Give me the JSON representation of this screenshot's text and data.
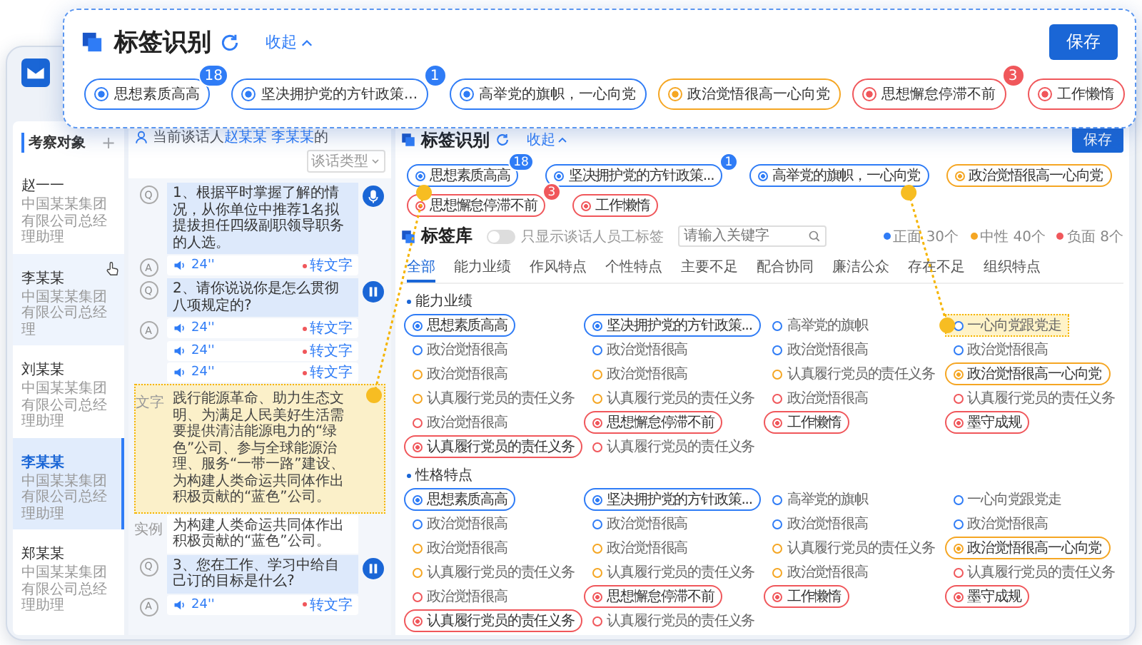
{
  "callout": {
    "title": "标签识别",
    "collapse": "收起",
    "save": "保存",
    "tags": [
      {
        "label": "思想素质高高",
        "color": "#2f7cf6",
        "selected": true,
        "badge": "18"
      },
      {
        "label": "坚决拥护党的方针政策...",
        "color": "#2f7cf6",
        "selected": true,
        "badge": "1"
      },
      {
        "label": "高举党的旗帜，一心向党",
        "color": "#2f7cf6",
        "selected": true
      },
      {
        "label": "政治觉悟很高一心向党",
        "color": "#f5a623",
        "selected": true
      },
      {
        "label": "思想懈怠停滞不前",
        "color": "#f0575b",
        "selected": true,
        "badge": "3"
      },
      {
        "label": "工作懒惰",
        "color": "#f0575b",
        "selected": true
      }
    ]
  },
  "candidates": {
    "title": "考察对象",
    "add": "+",
    "items": [
      {
        "name": "赵一一",
        "position": "中国某某集团有限公司总经理助理",
        "selected": false,
        "hovered": false
      },
      {
        "name": "李某某",
        "position": "中国某某集团有限公司总经理",
        "selected": false,
        "hovered": true
      },
      {
        "name": "刘某某",
        "position": "中国某某集团有限公司总经理助理",
        "selected": false,
        "hovered": false
      },
      {
        "name": "李某某",
        "position": "中国某某集团有限公司总经理助理",
        "selected": true,
        "hovered": false
      },
      {
        "name": "郑某某",
        "position": "中国某某集团有限公司总经理助理",
        "selected": false,
        "hovered": false
      }
    ]
  },
  "conversation": {
    "label": "当前谈话人",
    "names": "赵某某 李某某",
    "suffix": "的",
    "filter": "谈话类型",
    "items": [
      {
        "kind": "question",
        "marker": "Q",
        "text": "1、根据平时掌握了解的情况，从你单位中推荐1名拟提拔担任四级副职领导职务的人选。",
        "recording": true
      },
      {
        "kind": "audio",
        "marker": "A",
        "duration": "24''",
        "convert": "转文字"
      },
      {
        "kind": "question",
        "marker": "Q",
        "text": "2、请你说说你是怎么贯彻八项规定的?",
        "recording": false
      },
      {
        "kind": "audio",
        "marker": "A",
        "duration": "24''",
        "convert": "转文字"
      },
      {
        "kind": "audio",
        "duration": "24''",
        "convert": "转文字"
      },
      {
        "kind": "audio",
        "duration": "24''",
        "convert": "转文字"
      },
      {
        "kind": "transcript",
        "label": "文字",
        "text": "践行能源革命、助力生态文明、为满足人民美好生活需要提供清洁能源电力的“绿色”公司、参与全球能源治理、服务“一带一路”建设、为构建人类命运共同体作出积极贡献的“蓝色”公司。",
        "highlighted": true
      },
      {
        "kind": "example",
        "label": "实例",
        "text": "为构建人类命运共同体作出积极贡献的“蓝色”公司。"
      },
      {
        "kind": "question",
        "marker": "Q",
        "text": "3、您在工作、学习中给自己订的目标是什么?",
        "recording": false
      },
      {
        "kind": "audio",
        "marker": "A",
        "duration": "24''",
        "convert": "转文字"
      }
    ]
  },
  "tag_panel": {
    "title": "标签识别",
    "collapse": "收起",
    "save": "保存",
    "tags": [
      {
        "label": "思想素质高高",
        "color": "#2f7cf6",
        "selected": true,
        "badge": "18"
      },
      {
        "label": "坚决拥护党的方针政策...",
        "color": "#2f7cf6",
        "selected": true,
        "badge": "1"
      },
      {
        "label": "高举党的旗帜，一心向党",
        "color": "#2f7cf6",
        "selected": true
      },
      {
        "label": "政治觉悟很高一心向党",
        "color": "#f5a623",
        "selected": true
      },
      {
        "label": "思想懈怠停滞不前",
        "color": "#f0575b",
        "selected": true,
        "badge": "3"
      },
      {
        "label": "工作懒惰",
        "color": "#f0575b",
        "selected": true
      }
    ],
    "library": {
      "title": "标签库",
      "toggle": {
        "label": "只显示谈话人员工标签",
        "on": false
      },
      "search": {
        "placeholder": "请输入关键字"
      },
      "legend": [
        {
          "label": "正面 30个",
          "color": "#2f7cf6"
        },
        {
          "label": "中性 40个",
          "color": "#f5a623"
        },
        {
          "label": "负面 8个",
          "color": "#f0575b"
        }
      ],
      "tabs": [
        {
          "label": "全部",
          "selected": true
        },
        {
          "label": "能力业绩",
          "selected": false
        },
        {
          "label": "作风特点",
          "selected": false
        },
        {
          "label": "个性特点",
          "selected": false
        },
        {
          "label": "主要不足",
          "selected": false
        },
        {
          "label": "配合协同",
          "selected": false
        },
        {
          "label": "廉洁公众",
          "selected": false
        },
        {
          "label": "存在不足",
          "selected": false
        },
        {
          "label": "组织特点",
          "selected": false
        }
      ],
      "sections": [
        {
          "title": "能力业绩",
          "tags": [
            {
              "label": "思想素质高高",
              "color": "#2f7cf6",
              "selected": true,
              "highlighted": false
            },
            {
              "label": "坚决拥护党的方针政策...",
              "color": "#2f7cf6",
              "selected": true,
              "highlighted": false
            },
            {
              "label": "高举党的旗帜",
              "color": "#2f7cf6",
              "selected": false,
              "highlighted": false
            },
            {
              "label": "一心向党跟党走",
              "color": "#2f7cf6",
              "selected": false,
              "highlighted": true
            },
            {
              "label": "政治觉悟很高",
              "color": "#2f7cf6",
              "selected": false,
              "highlighted": false
            },
            {
              "label": "政治觉悟很高",
              "color": "#2f7cf6",
              "selected": false,
              "highlighted": false
            },
            {
              "label": "政治觉悟很高",
              "color": "#2f7cf6",
              "selected": false,
              "highlighted": false
            },
            {
              "label": "政治觉悟很高",
              "color": "#2f7cf6",
              "selected": false,
              "highlighted": false
            },
            {
              "label": "政治觉悟很高",
              "color": "#f5a623",
              "selected": false,
              "highlighted": false
            },
            {
              "label": "政治觉悟很高",
              "color": "#f5a623",
              "selected": false,
              "highlighted": false
            },
            {
              "label": "认真履行党员的责任义务",
              "color": "#f5a623",
              "selected": false,
              "highlighted": false
            },
            {
              "label": "政治觉悟很高一心向党",
              "color": "#f5a623",
              "selected": true,
              "highlighted": false
            },
            {
              "label": "认真履行党员的责任义务",
              "color": "#f5a623",
              "selected": false,
              "highlighted": false
            },
            {
              "label": "认真履行党员的责任义务",
              "color": "#f5a623",
              "selected": false,
              "highlighted": false
            },
            {
              "label": "政治觉悟很高",
              "color": "#f0575b",
              "selected": false,
              "highlighted": false
            },
            {
              "label": "认真履行党员的责任义务",
              "color": "#f0575b",
              "selected": false,
              "highlighted": false
            },
            {
              "label": "政治觉悟很高",
              "color": "#f0575b",
              "selected": false,
              "highlighted": false
            },
            {
              "label": "思想懈怠停滞不前",
              "color": "#f0575b",
              "selected": true,
              "highlighted": false
            },
            {
              "label": "工作懒惰",
              "color": "#f0575b",
              "selected": true,
              "highlighted": false
            },
            {
              "label": "墨守成规",
              "color": "#f0575b",
              "selected": true,
              "highlighted": false
            },
            {
              "label": "认真履行党员的责任义务",
              "color": "#f0575b",
              "selected": true,
              "highlighted": false
            },
            {
              "label": "认真履行党员的责任义务",
              "color": "#f0575b",
              "selected": false,
              "highlighted": false
            }
          ]
        },
        {
          "title": "性格特点",
          "tags": [
            {
              "label": "思想素质高高",
              "color": "#2f7cf6",
              "selected": true,
              "highlighted": false
            },
            {
              "label": "坚决拥护党的方针政策...",
              "color": "#2f7cf6",
              "selected": true,
              "highlighted": false
            },
            {
              "label": "高举党的旗帜",
              "color": "#2f7cf6",
              "selected": false,
              "highlighted": false
            },
            {
              "label": "一心向党跟党走",
              "color": "#2f7cf6",
              "selected": false,
              "highlighted": false
            },
            {
              "label": "政治觉悟很高",
              "color": "#2f7cf6",
              "selected": false,
              "highlighted": false
            },
            {
              "label": "政治觉悟很高",
              "color": "#2f7cf6",
              "selected": false,
              "highlighted": false
            },
            {
              "label": "政治觉悟很高",
              "color": "#2f7cf6",
              "selected": false,
              "highlighted": false
            },
            {
              "label": "政治觉悟很高",
              "color": "#2f7cf6",
              "selected": false,
              "highlighted": false
            },
            {
              "label": "政治觉悟很高",
              "color": "#f5a623",
              "selected": false,
              "highlighted": false
            },
            {
              "label": "政治觉悟很高",
              "color": "#f5a623",
              "selected": false,
              "highlighted": false
            },
            {
              "label": "认真履行党员的责任义务",
              "color": "#f5a623",
              "selected": false,
              "highlighted": false
            },
            {
              "label": "政治觉悟很高一心向党",
              "color": "#f5a623",
              "selected": true,
              "highlighted": false
            },
            {
              "label": "认真履行党员的责任义务",
              "color": "#f5a623",
              "selected": false,
              "highlighted": false
            },
            {
              "label": "认真履行党员的责任义务",
              "color": "#f5a623",
              "selected": false,
              "highlighted": false
            },
            {
              "label": "政治觉悟很高",
              "color": "#f5a623",
              "selected": false,
              "highlighted": false
            },
            {
              "label": "认真履行党员的责任义务",
              "color": "#f0575b",
              "selected": false,
              "highlighted": false
            },
            {
              "label": "政治觉悟很高",
              "color": "#f0575b",
              "selected": false,
              "highlighted": false
            },
            {
              "label": "思想懈怠停滞不前",
              "color": "#f0575b",
              "selected": true,
              "highlighted": false
            },
            {
              "label": "工作懒惰",
              "color": "#f0575b",
              "selected": true,
              "highlighted": false
            },
            {
              "label": "墨守成规",
              "color": "#f0575b",
              "selected": true,
              "highlighted": false
            },
            {
              "label": "认真履行党员的责任义务",
              "color": "#f0575b",
              "selected": true,
              "highlighted": false
            },
            {
              "label": "认真履行党员的责任义务",
              "color": "#f0575b",
              "selected": false,
              "highlighted": false
            }
          ]
        }
      ]
    }
  }
}
